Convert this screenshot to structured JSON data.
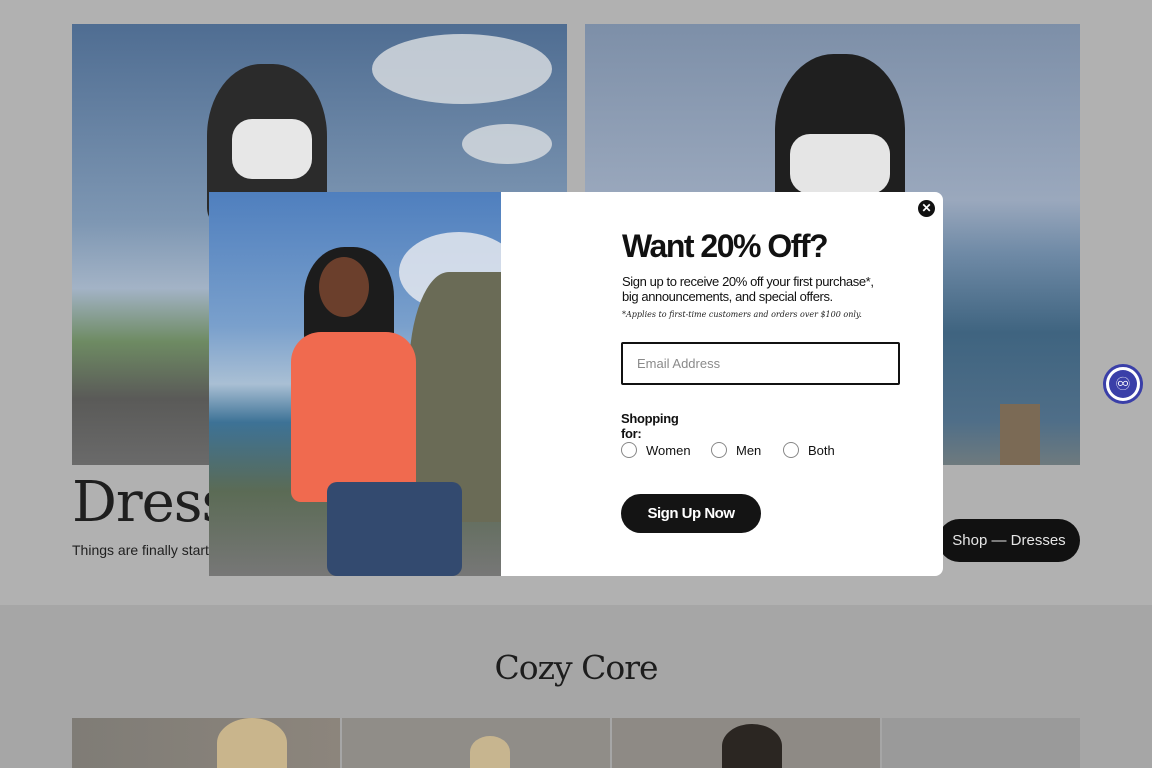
{
  "hero": {
    "title": "Dress t",
    "subtitle": "Things are finally starti",
    "shop_button": "Shop — Dresses"
  },
  "collection": {
    "title": "Cozy Core"
  },
  "modal": {
    "title": "Want 20% Off?",
    "description": "Sign up to receive 20% off your first purchase*, big announcements, and special offers.",
    "fine_print": "*Applies to first-time customers and orders over $100 only.",
    "email_placeholder": "Email Address",
    "shopping_for_label": "Shopping for:",
    "options": [
      "Women",
      "Men",
      "Both"
    ],
    "signup_button": "Sign Up Now",
    "close_icon": "close-icon"
  },
  "accessibility": {
    "icon": "accessibility-icon"
  },
  "colors": {
    "overlay": "#a9a9a9",
    "button": "#111111",
    "accessibility_accent": "#3a3fa8"
  }
}
